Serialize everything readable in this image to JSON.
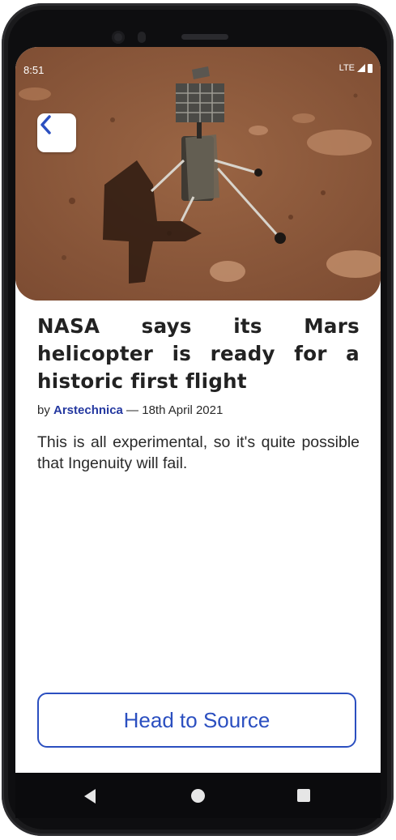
{
  "status_bar": {
    "time": "8:51",
    "network": "LTE"
  },
  "article": {
    "title": "NASA says its Mars helicopter is ready for a historic first flight",
    "byline_prefix": "by",
    "source_name": "Arstechnica",
    "byline_sep": " — ",
    "date": "18th April 2021",
    "body": "This is all experimental, so it's quite possible that Ingenuity will fail."
  },
  "actions": {
    "source_button_label": "Head to Source"
  },
  "icons": {
    "back": "chevron-left-icon",
    "nav_back": "triangle-back-icon",
    "nav_home": "circle-home-icon",
    "nav_recent": "square-recents-icon"
  },
  "colors": {
    "accent": "#2b4fc0",
    "source_link": "#2438a0",
    "mars_ground": "#8e5a3c"
  }
}
